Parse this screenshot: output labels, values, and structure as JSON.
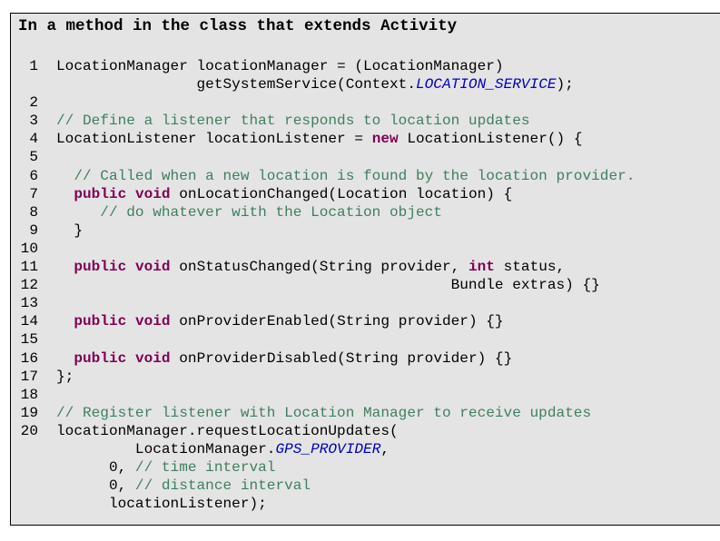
{
  "title": "In a method in the class that extends Activity",
  "colors": {
    "keyword": "#7f0055",
    "comment": "#3f7f5f",
    "constant": "#0000c0",
    "background": "#e4e4e4"
  },
  "lines": [
    {
      "n": "1",
      "parts": [
        {
          "t": "LocationManager locationManager = (LocationManager)",
          "c": ""
        }
      ]
    },
    {
      "n": "",
      "parts": [
        {
          "t": "                getSystemService(Context.",
          "c": ""
        },
        {
          "t": "LOCATION_SERVICE",
          "c": "cst"
        },
        {
          "t": ");",
          "c": ""
        }
      ]
    },
    {
      "n": "2",
      "parts": []
    },
    {
      "n": "3",
      "parts": [
        {
          "t": "// Define a listener that responds to location updates",
          "c": "cm"
        }
      ]
    },
    {
      "n": "4",
      "parts": [
        {
          "t": "LocationListener locationListener = ",
          "c": ""
        },
        {
          "t": "new",
          "c": "kw"
        },
        {
          "t": " LocationListener() {",
          "c": ""
        }
      ]
    },
    {
      "n": "5",
      "parts": []
    },
    {
      "n": "6",
      "parts": [
        {
          "t": "  // Called when a new location is found by the location provider.",
          "c": "cm"
        }
      ]
    },
    {
      "n": "7",
      "parts": [
        {
          "t": "  ",
          "c": ""
        },
        {
          "t": "public",
          "c": "kw"
        },
        {
          "t": " ",
          "c": ""
        },
        {
          "t": "void",
          "c": "kw"
        },
        {
          "t": " onLocationChanged(Location location) {",
          "c": ""
        }
      ]
    },
    {
      "n": "8",
      "parts": [
        {
          "t": "     // do whatever with the Location object",
          "c": "cm"
        }
      ]
    },
    {
      "n": "9",
      "parts": [
        {
          "t": "  }",
          "c": ""
        }
      ]
    },
    {
      "n": "10",
      "parts": []
    },
    {
      "n": "11",
      "parts": [
        {
          "t": "  ",
          "c": ""
        },
        {
          "t": "public",
          "c": "kw"
        },
        {
          "t": " ",
          "c": ""
        },
        {
          "t": "void",
          "c": "kw"
        },
        {
          "t": " onStatusChanged(String provider, ",
          "c": ""
        },
        {
          "t": "int",
          "c": "kw"
        },
        {
          "t": " status,",
          "c": ""
        }
      ]
    },
    {
      "n": "12",
      "parts": [
        {
          "t": "                                             Bundle extras) {}",
          "c": ""
        }
      ]
    },
    {
      "n": "13",
      "parts": []
    },
    {
      "n": "14",
      "parts": [
        {
          "t": "  ",
          "c": ""
        },
        {
          "t": "public",
          "c": "kw"
        },
        {
          "t": " ",
          "c": ""
        },
        {
          "t": "void",
          "c": "kw"
        },
        {
          "t": " onProviderEnabled(String provider) {}",
          "c": ""
        }
      ]
    },
    {
      "n": "15",
      "parts": []
    },
    {
      "n": "16",
      "parts": [
        {
          "t": "  ",
          "c": ""
        },
        {
          "t": "public",
          "c": "kw"
        },
        {
          "t": " ",
          "c": ""
        },
        {
          "t": "void",
          "c": "kw"
        },
        {
          "t": " onProviderDisabled(String provider) {}",
          "c": ""
        }
      ]
    },
    {
      "n": "17",
      "parts": [
        {
          "t": "};",
          "c": ""
        }
      ]
    },
    {
      "n": "18",
      "parts": []
    },
    {
      "n": "19",
      "parts": [
        {
          "t": "// Register listener with Location Manager to receive updates",
          "c": "cm"
        }
      ]
    },
    {
      "n": "20",
      "parts": [
        {
          "t": "locationManager.requestLocationUpdates(",
          "c": ""
        }
      ]
    },
    {
      "n": "",
      "parts": [
        {
          "t": "         LocationManager.",
          "c": ""
        },
        {
          "t": "GPS_PROVIDER",
          "c": "cst"
        },
        {
          "t": ",",
          "c": ""
        }
      ]
    },
    {
      "n": "",
      "parts": [
        {
          "t": "      0, ",
          "c": ""
        },
        {
          "t": "// time interval",
          "c": "cm"
        }
      ]
    },
    {
      "n": "",
      "parts": [
        {
          "t": "      0, ",
          "c": ""
        },
        {
          "t": "// distance interval",
          "c": "cm"
        }
      ]
    },
    {
      "n": "",
      "parts": [
        {
          "t": "      locationListener);",
          "c": ""
        }
      ]
    }
  ]
}
